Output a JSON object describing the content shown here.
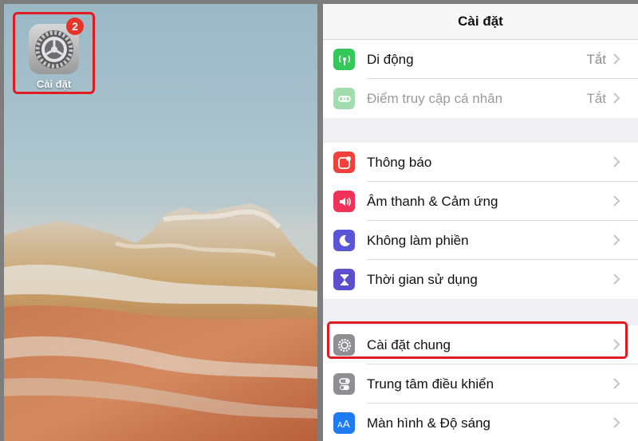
{
  "home": {
    "app_label": "Cài đặt",
    "badge_count": "2",
    "app_icon": "settings-gear-icon"
  },
  "settings": {
    "title": "Cài đặt",
    "groups": [
      [
        {
          "label": "Di động",
          "value": "Tắt",
          "icon": "antenna-icon",
          "color": "#34c759"
        },
        {
          "label": "Điểm truy cập cá nhân",
          "value": "Tắt",
          "icon": "hotspot-chain-icon",
          "color": "#a3dcae"
        }
      ],
      [
        {
          "label": "Thông báo",
          "icon": "notification-icon",
          "color": "#f2403a"
        },
        {
          "label": "Âm thanh & Cảm ứng",
          "icon": "speaker-icon",
          "color": "#f0325a"
        },
        {
          "label": "Không làm phiền",
          "icon": "moon-icon",
          "color": "#5856d6"
        },
        {
          "label": "Thời gian sử dụng",
          "icon": "hourglass-icon",
          "color": "#5b4fd0"
        }
      ],
      [
        {
          "label": "Cài đặt chung",
          "icon": "gear-icon",
          "color": "#8e8e93"
        },
        {
          "label": "Trung tâm điều khiển",
          "icon": "toggle-switches-icon",
          "color": "#8e8e93"
        },
        {
          "label": "Màn hình & Độ sáng",
          "icon": "text-size-icon",
          "color": "#1e7cf0"
        }
      ]
    ]
  }
}
